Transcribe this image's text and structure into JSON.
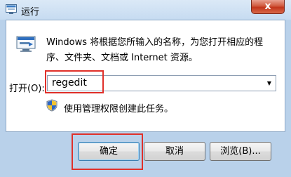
{
  "window": {
    "title": "运行",
    "close_glyph": "x"
  },
  "icons": {
    "title": "run-icon",
    "main": "run-icon",
    "admin": "uac-shield-icon"
  },
  "dialog": {
    "description": "Windows 将根据您所输入的名称，为您打开相应的程序、文件夹、文档或 Internet 资源。",
    "open_label": "打开(O):",
    "open_value": "regedit",
    "admin_note": "使用管理权限创建此任务。"
  },
  "buttons": {
    "ok": "确定",
    "cancel": "取消",
    "browse": "浏览(B)..."
  },
  "colors": {
    "highlight": "#e0302a",
    "title_bar": "#c6dbf1",
    "close": "#c2351b"
  }
}
